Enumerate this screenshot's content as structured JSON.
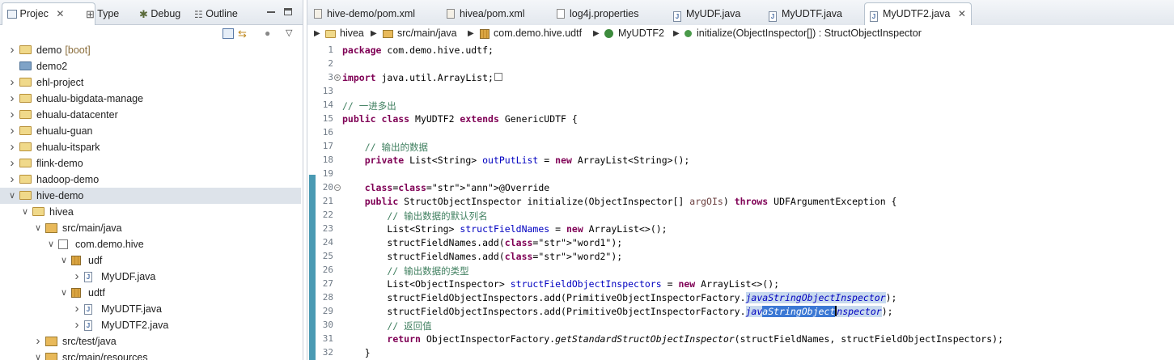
{
  "left_panel": {
    "tabs": [
      {
        "label": "Projec",
        "icon": "package-explorer-icon",
        "active": true
      },
      {
        "label": "Type",
        "icon": "type-hierarchy-icon"
      },
      {
        "label": "Debug",
        "icon": "debug-icon"
      },
      {
        "label": "Outline",
        "icon": "outline-icon"
      }
    ],
    "tree": [
      {
        "label": "demo",
        "decoration": "[boot]",
        "depth": 0,
        "state": "collapsed",
        "icon": "project-folder-icon"
      },
      {
        "label": "demo2",
        "depth": 0,
        "state": "none",
        "icon": "folder-icon"
      },
      {
        "label": "ehl-project",
        "depth": 0,
        "state": "collapsed",
        "icon": "project-folder-icon"
      },
      {
        "label": "ehualu-bigdata-manage",
        "depth": 0,
        "state": "collapsed",
        "icon": "project-folder-icon"
      },
      {
        "label": "ehualu-datacenter",
        "depth": 0,
        "state": "collapsed",
        "icon": "project-folder-icon"
      },
      {
        "label": "ehualu-guan",
        "depth": 0,
        "state": "collapsed",
        "icon": "project-folder-icon"
      },
      {
        "label": "ehualu-itspark",
        "depth": 0,
        "state": "collapsed",
        "icon": "project-folder-icon"
      },
      {
        "label": "flink-demo",
        "depth": 0,
        "state": "collapsed",
        "icon": "project-folder-icon"
      },
      {
        "label": "hadoop-demo",
        "depth": 0,
        "state": "collapsed",
        "icon": "project-folder-icon"
      },
      {
        "label": "hive-demo",
        "depth": 0,
        "state": "expanded",
        "icon": "project-folder-icon",
        "selected": true
      },
      {
        "label": "hivea",
        "depth": 1,
        "state": "expanded",
        "icon": "project-folder-icon"
      },
      {
        "label": "src/main/java",
        "depth": 2,
        "state": "expanded",
        "icon": "source-folder-icon"
      },
      {
        "label": "com.demo.hive",
        "depth": 3,
        "state": "expanded",
        "icon": "empty-package-icon"
      },
      {
        "label": "udf",
        "depth": 4,
        "state": "expanded",
        "icon": "package-icon"
      },
      {
        "label": "MyUDF.java",
        "depth": 5,
        "state": "collapsed",
        "icon": "java-file-icon"
      },
      {
        "label": "udtf",
        "depth": 4,
        "state": "expanded",
        "icon": "package-icon"
      },
      {
        "label": "MyUDTF.java",
        "depth": 5,
        "state": "collapsed",
        "icon": "java-file-icon"
      },
      {
        "label": "MyUDTF2.java",
        "depth": 5,
        "state": "collapsed",
        "icon": "java-file-icon"
      },
      {
        "label": "src/test/java",
        "depth": 2,
        "state": "collapsed",
        "icon": "source-folder-icon"
      },
      {
        "label": "src/main/resources",
        "depth": 2,
        "state": "expanded",
        "icon": "source-folder-icon"
      }
    ]
  },
  "editor": {
    "tabs": [
      {
        "label": "hive-demo/pom.xml",
        "icon": "xml-file-icon"
      },
      {
        "label": "hivea/pom.xml",
        "icon": "xml-file-icon"
      },
      {
        "label": "log4j.properties",
        "icon": "properties-file-icon"
      },
      {
        "label": "MyUDF.java",
        "icon": "java-file-icon"
      },
      {
        "label": "MyUDTF.java",
        "icon": "java-file-icon"
      },
      {
        "label": "MyUDTF2.java",
        "icon": "java-file-icon",
        "active": true
      }
    ],
    "breadcrumb": [
      "hivea",
      "src/main/java",
      "com.demo.hive.udtf",
      "MyUDTF2",
      "initialize(ObjectInspector[]) : StructObjectInspector"
    ],
    "lines": [
      {
        "n": "1",
        "text": "package com.demo.hive.udtf;"
      },
      {
        "n": "2",
        "text": ""
      },
      {
        "n": "3",
        "text": "import java.util.ArrayList;"
      },
      {
        "n": "13",
        "text": ""
      },
      {
        "n": "14",
        "text": "// 一进多出"
      },
      {
        "n": "15",
        "text": "public class MyUDTF2 extends GenericUDTF {"
      },
      {
        "n": "16",
        "text": ""
      },
      {
        "n": "17",
        "text": "    // 输出的数据"
      },
      {
        "n": "18",
        "text": "    private List<String> outPutList = new ArrayList<String>();"
      },
      {
        "n": "19",
        "text": ""
      },
      {
        "n": "20",
        "text": "    @Override"
      },
      {
        "n": "21",
        "text": "    public StructObjectInspector initialize(ObjectInspector[] argOIs) throws UDFArgumentException {"
      },
      {
        "n": "22",
        "text": "        // 输出数据的默认列名"
      },
      {
        "n": "23",
        "text": "        List<String> structFieldNames = new ArrayList<>();"
      },
      {
        "n": "24",
        "text": "        structFieldNames.add(\"word1\");"
      },
      {
        "n": "25",
        "text": "        structFieldNames.add(\"word2\");"
      },
      {
        "n": "26",
        "text": "        // 输出数据的类型"
      },
      {
        "n": "27",
        "text": "        List<ObjectInspector> structFieldObjectInspectors = new ArrayList<>();"
      },
      {
        "n": "28",
        "text": "        structFieldObjectInspectors.add(PrimitiveObjectInspectorFactory.javaStringObjectInspector);"
      },
      {
        "n": "29",
        "text": "        structFieldObjectInspectors.add(PrimitiveObjectInspectorFactory.javaStringObjectInspector);"
      },
      {
        "n": "30",
        "text": "        // 返回值"
      },
      {
        "n": "31",
        "text": "        return ObjectInspectorFactory.getStandardStructObjectInspector(structFieldNames, structFieldObjectInspectors);"
      },
      {
        "n": "32",
        "text": "    }"
      }
    ]
  },
  "colors": {
    "keyword": "#7f0055",
    "comment": "#3f7f5f",
    "string": "#2a00ff",
    "field": "#0000c0",
    "selection": "#3b78d4",
    "occurrence": "#c7d9ee"
  }
}
